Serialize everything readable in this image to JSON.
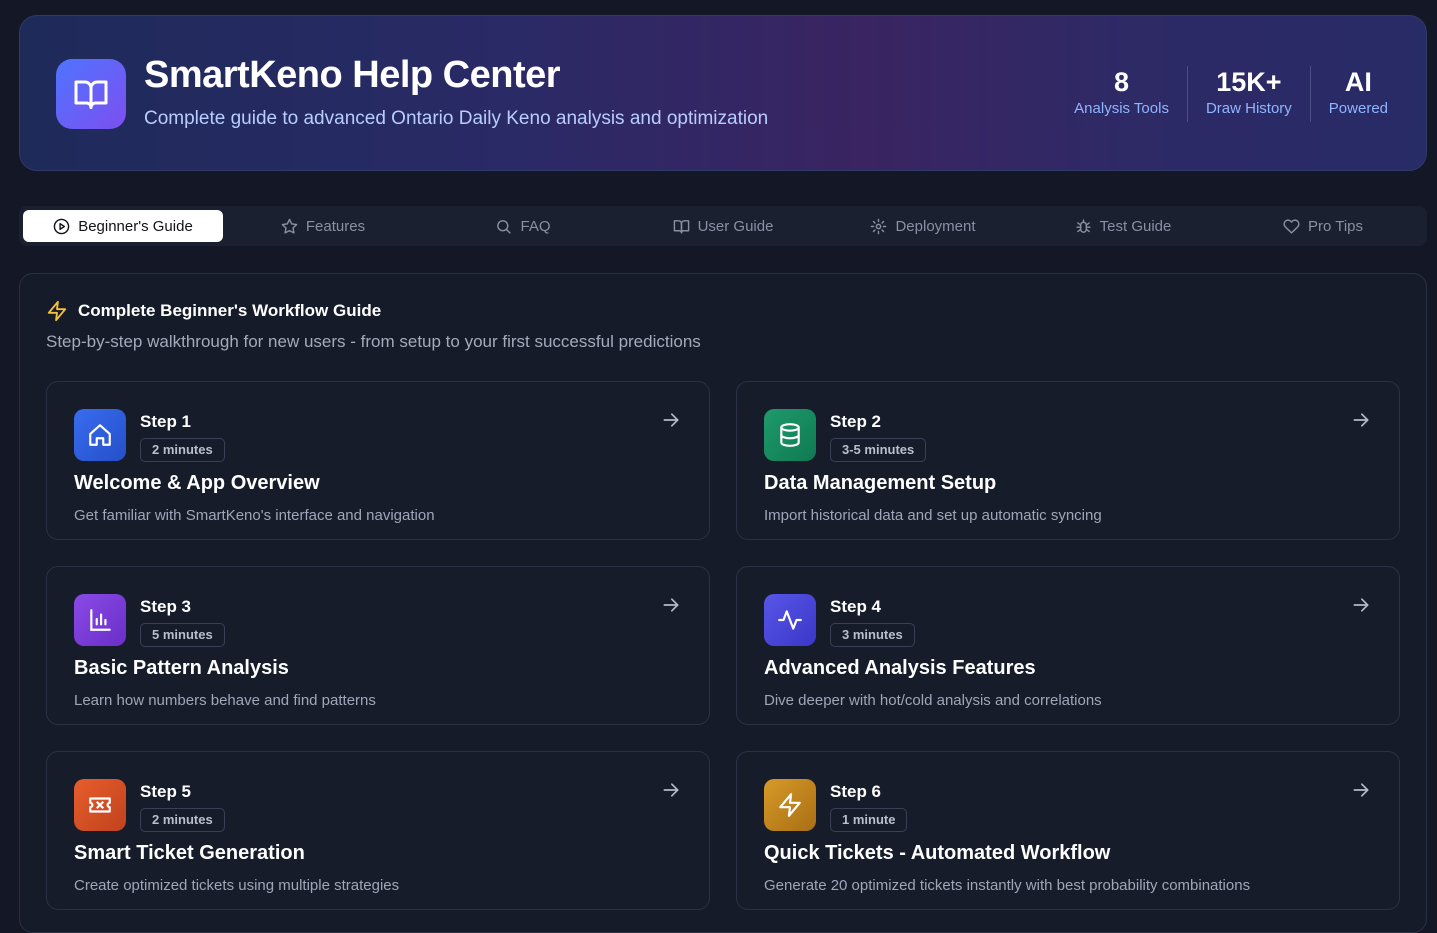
{
  "header": {
    "title": "SmartKeno Help Center",
    "subtitle": "Complete guide to advanced Ontario Daily Keno analysis and optimization",
    "icon": "book-open-icon",
    "stats": [
      {
        "value": "8",
        "label": "Analysis Tools"
      },
      {
        "value": "15K+",
        "label": "Draw History"
      },
      {
        "value": "AI",
        "label": "Powered"
      }
    ]
  },
  "tabs": [
    {
      "label": "Beginner's Guide",
      "icon": "play-circle-icon",
      "active": true
    },
    {
      "label": "Features",
      "icon": "star-icon"
    },
    {
      "label": "FAQ",
      "icon": "search-icon"
    },
    {
      "label": "User Guide",
      "icon": "book-icon"
    },
    {
      "label": "Deployment",
      "icon": "gear-icon"
    },
    {
      "label": "Test Guide",
      "icon": "bug-icon"
    },
    {
      "label": "Pro Tips",
      "icon": "heart-icon"
    }
  ],
  "section": {
    "title": "Complete Beginner's Workflow Guide",
    "subtitle": "Step-by-step walkthrough for new users - from setup to your first successful predictions",
    "icon": "lightning-icon"
  },
  "steps": [
    {
      "step": "Step 1",
      "time": "2 minutes",
      "title": "Welcome & App Overview",
      "desc": "Get familiar with SmartKeno's interface and navigation",
      "icon": "home-icon",
      "color": "#2f5ee0"
    },
    {
      "step": "Step 2",
      "time": "3-5 minutes",
      "title": "Data Management Setup",
      "desc": "Import historical data and set up automatic syncing",
      "icon": "database-icon",
      "color": "#138a5e"
    },
    {
      "step": "Step 3",
      "time": "5 minutes",
      "title": "Basic Pattern Analysis",
      "desc": "Learn how numbers behave and find patterns",
      "icon": "bar-chart-icon",
      "color": "#7a3fd8"
    },
    {
      "step": "Step 4",
      "time": "3 minutes",
      "title": "Advanced Analysis Features",
      "desc": "Dive deeper with hot/cold analysis and correlations",
      "icon": "activity-icon",
      "color": "#4a47d8"
    },
    {
      "step": "Step 5",
      "time": "2 minutes",
      "title": "Smart Ticket Generation",
      "desc": "Create optimized tickets using multiple strategies",
      "icon": "ticket-icon",
      "color": "#d6502a"
    },
    {
      "step": "Step 6",
      "time": "1 minute",
      "title": "Quick Tickets - Automated Workflow",
      "desc": "Generate 20 optimized tickets instantly with best probability combinations",
      "icon": "lightning-icon",
      "color": "#c88a1e"
    }
  ]
}
